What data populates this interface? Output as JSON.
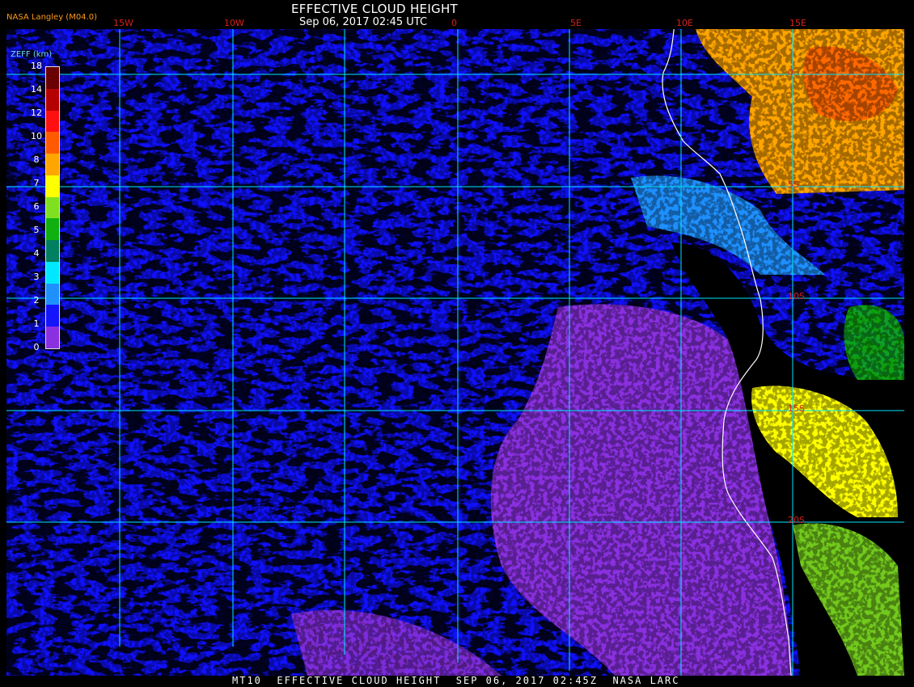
{
  "header": {
    "title": "EFFECTIVE CLOUD HEIGHT",
    "subtitle": "Sep 06, 2017 02:45 UTC",
    "credit": "NASA Langley (M04.0)"
  },
  "footer": {
    "text": "MT10  EFFECTIVE CLOUD HEIGHT  SEP 06, 2017 02:45Z  NASA LARC"
  },
  "map": {
    "lon_labels": [
      "15W",
      "10W",
      "0",
      "5E",
      "10E",
      "15E"
    ],
    "lat_labels": [
      "0",
      "5S",
      "10S",
      "15S",
      "20S"
    ],
    "colors": {
      "grid": "#00e5ff",
      "coastline": "#ffffff",
      "clear": "#000000",
      "ocean_low": "#1010ff"
    }
  },
  "legend": {
    "title": "ZEFF (km)",
    "ticks": [
      "18",
      "14",
      "12",
      "10",
      "8",
      "7",
      "6",
      "5",
      "4",
      "3",
      "2",
      "1",
      "0"
    ],
    "colors": [
      "#6b0000",
      "#b40000",
      "#ff1010",
      "#ff5a00",
      "#ffa500",
      "#ffff00",
      "#7fe020",
      "#10b010",
      "#008060",
      "#00e8ff",
      "#1e90ff",
      "#1414ff",
      "#8a30e0"
    ]
  }
}
